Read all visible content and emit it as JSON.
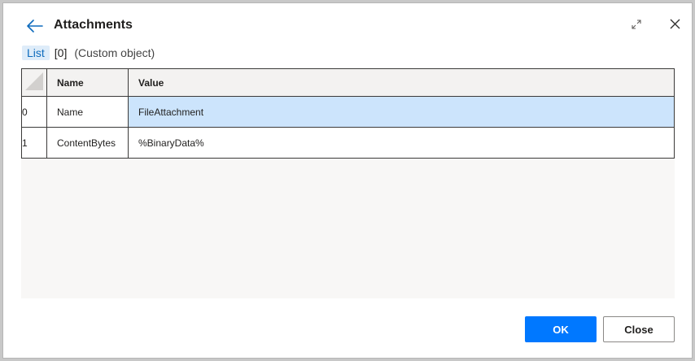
{
  "dialog": {
    "title": "Attachments",
    "accent": "#0078ff"
  },
  "breadcrumb": {
    "link": "List",
    "index": "[0]",
    "type": "(Custom object)"
  },
  "table": {
    "columns": [
      "Name",
      "Value"
    ],
    "rows": [
      {
        "index": "0",
        "name": "Name",
        "value": "FileAttachment"
      },
      {
        "index": "1",
        "name": "ContentBytes",
        "value": "%BinaryData%"
      }
    ]
  },
  "buttons": {
    "ok": "OK",
    "close": "Close"
  },
  "icons": {
    "back": "arrow-left-icon",
    "expand": "expand-icon",
    "close": "close-icon"
  }
}
